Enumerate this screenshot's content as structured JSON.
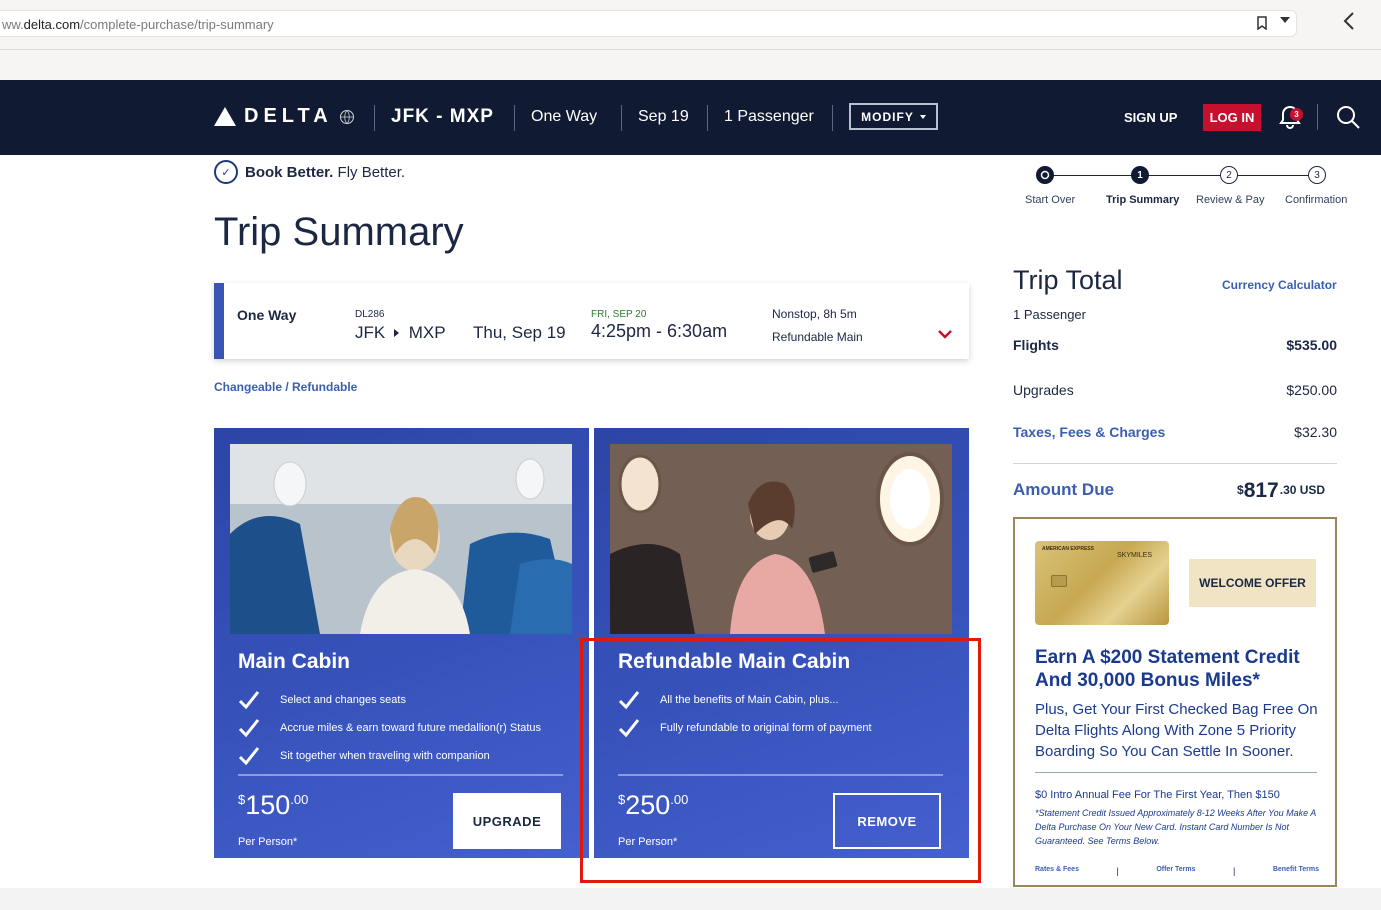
{
  "browser": {
    "url_prefix": "ww.",
    "url_domain": "delta.com",
    "url_path": "/complete-purchase/trip-summary"
  },
  "header": {
    "logo_text": "DELTA",
    "route": "JFK - MXP",
    "trip_type": "One Way",
    "date": "Sep 19",
    "passengers": "1 Passenger",
    "modify_label": "MODIFY",
    "signup_label": "SIGN UP",
    "login_label": "LOG IN",
    "notification_count": "3"
  },
  "tagline": {
    "bold": "Book Better.",
    "rest": " Fly Better."
  },
  "steps": {
    "start_over": "Start Over",
    "items": [
      {
        "num": "1",
        "label": "Trip Summary"
      },
      {
        "num": "2",
        "label": "Review & Pay"
      },
      {
        "num": "3",
        "label": "Confirmation"
      }
    ]
  },
  "page_title": "Trip Summary",
  "flight": {
    "trip_type": "One Way",
    "flight_number": "DL286",
    "origin": "JFK",
    "destination": "MXP",
    "depart_date": "Thu, Sep 19",
    "arrival_date": "FRI, SEP 20",
    "times": "4:25pm - 6:30am",
    "stops": "Nonstop, 8h 5m",
    "fare": "Refundable Main"
  },
  "changeable_link": "Changeable / Refundable",
  "cabins": [
    {
      "title": "Main Cabin",
      "features": [
        "Select and changes seats",
        "Accrue miles & earn toward future medallion(r) Status",
        "Sit together when traveling with companion"
      ],
      "currency": "$",
      "price": "150",
      "cents": ".00",
      "per_person": "Per Person*",
      "button": "UPGRADE"
    },
    {
      "title": "Refundable Main Cabin",
      "features": [
        "All the benefits of Main Cabin, plus...",
        "Fully refundable to original form of payment"
      ],
      "currency": "$",
      "price": "250",
      "cents": ".00",
      "per_person": "Per Person*",
      "button": "REMOVE"
    }
  ],
  "trip_total": {
    "title": "Trip Total",
    "currency_calculator": "Currency Calculator",
    "passengers": "1 Passenger",
    "rows": [
      {
        "label": "Flights",
        "value": "$535.00"
      },
      {
        "label": "Upgrades",
        "value": "$250.00"
      },
      {
        "label": "Taxes, Fees & Charges",
        "value": "$32.30"
      }
    ],
    "amount_due_label": "Amount Due",
    "amount_due_currency": "$",
    "amount_due_main": "817",
    "amount_due_cents": ".30 USD"
  },
  "offer": {
    "card_brand": "AMERICAN EXPRESS",
    "card_name": "SKYMILES",
    "welcome": "WELCOME OFFER",
    "headline": "Earn A $200 Statement Credit And 30,000 Bonus Miles*",
    "body": "Plus, Get Your First Checked Bag Free On Delta Flights Along With Zone 5 Priority Boarding So You Can Settle In Sooner.",
    "fee": "$0 Intro Annual Fee For The First Year, Then $150",
    "fine_print": "*Statement Credit Issued Approximately 8-12 Weeks After You Make A Delta Purchase On Your New Card. Instant Card Number Is Not Guaranteed. See Terms Below.",
    "links": [
      "Rates & Fees",
      "Offer Terms",
      "Benefit Terms"
    ]
  },
  "colors": {
    "header_bg": "#111a33",
    "brand_red": "#c8102e",
    "cabin_blue": "#3753bb",
    "link_blue": "#3a5fb0",
    "highlight_red": "#e0190b"
  }
}
